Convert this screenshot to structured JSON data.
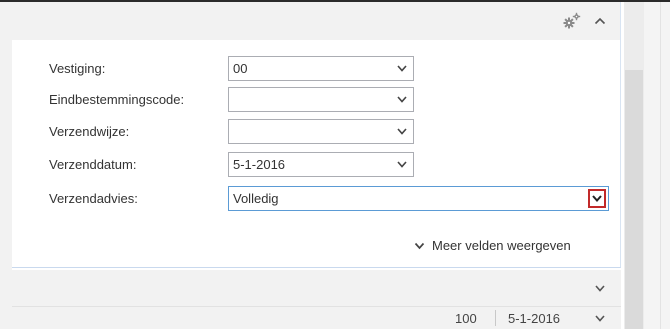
{
  "fields": [
    {
      "label": "Vestiging:",
      "value": "00"
    },
    {
      "label": "Eindbestemmingscode:",
      "value": ""
    },
    {
      "label": "Verzendwijze:",
      "value": ""
    },
    {
      "label": "Verzenddatum:",
      "value": "5-1-2016"
    },
    {
      "label": "Verzendadvies:",
      "value": "Volledig"
    }
  ],
  "more_fields_label": "Meer velden weergeven",
  "lines": {
    "quantity": "100",
    "date": "5-1-2016"
  },
  "icons": {
    "header_gear": "gear-icon",
    "collapse": "chevron-up-icon",
    "dropdown": "chevron-down-icon"
  },
  "colors": {
    "focus_border": "#5b9bd5",
    "dropdown_highlight": "#c22a2a",
    "header_bg": "#f2f2f2"
  }
}
